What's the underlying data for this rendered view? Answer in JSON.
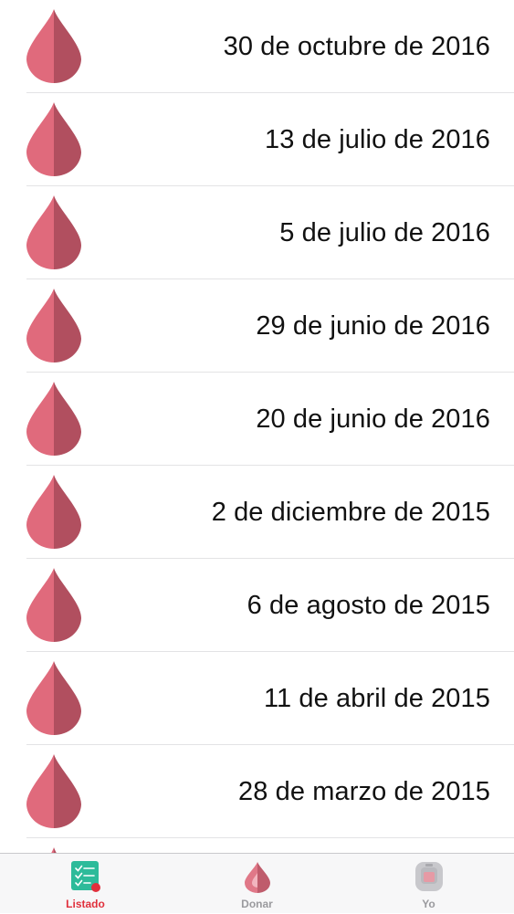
{
  "donations": [
    {
      "date": "30 de octubre de 2016",
      "icon": "blood-drop-icon"
    },
    {
      "date": "13 de julio de 2016",
      "icon": "blood-drop-icon"
    },
    {
      "date": "5 de julio de 2016",
      "icon": "blood-drop-icon"
    },
    {
      "date": "29 de junio de 2016",
      "icon": "blood-drop-icon"
    },
    {
      "date": "20 de junio de 2016",
      "icon": "blood-drop-icon"
    },
    {
      "date": "2 de diciembre de 2015",
      "icon": "blood-drop-icon"
    },
    {
      "date": "6 de agosto de 2015",
      "icon": "blood-drop-icon"
    },
    {
      "date": "11 de abril de 2015",
      "icon": "blood-drop-icon"
    },
    {
      "date": "28 de marzo de 2015",
      "icon": "blood-drop-icon"
    },
    {
      "date": "",
      "icon": "blood-drop-icon"
    }
  ],
  "tabbar": {
    "tabs": [
      {
        "label": "Listado",
        "icon": "checklist-icon",
        "selected": true
      },
      {
        "label": "Donar",
        "icon": "blood-drop-icon",
        "selected": false
      },
      {
        "label": "Yo",
        "icon": "blood-bag-icon",
        "selected": false
      }
    ]
  },
  "colors": {
    "drop_light": "#e06a7c",
    "drop_dark": "#b14f5f",
    "tab_active": "#e0303c",
    "tab_inactive": "#9a9a9e",
    "checklist_bg": "#2dbb9a",
    "separator": "#e3e3e5"
  }
}
